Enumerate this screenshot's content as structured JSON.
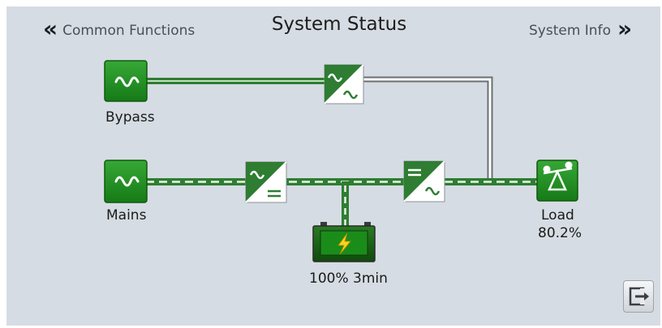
{
  "nav": {
    "left_chevron": "«",
    "left_label": "Common Functions",
    "right_label": "System Info",
    "right_chevron": "»"
  },
  "title": "System Status",
  "diagram": {
    "bypass": {
      "label": "Bypass",
      "icon": "sine-wave-icon"
    },
    "mains": {
      "label": "Mains",
      "icon": "sine-wave-icon"
    },
    "static_switch": {
      "icon": "ac-ac-converter-icon"
    },
    "rectifier": {
      "icon": "ac-dc-rectifier-icon"
    },
    "inverter": {
      "icon": "dc-ac-inverter-icon"
    },
    "battery": {
      "label": "100% 3min",
      "icon": "battery-lightning-icon"
    },
    "load": {
      "label": "Load",
      "value": "80.2%",
      "icon": "load-balance-icon"
    }
  },
  "exit": {
    "icon": "exit-icon"
  },
  "colors": {
    "background": "#d6dce3",
    "block_green": "#1f8a1f",
    "line_green": "#2e7d32",
    "battery_dark": "#15540f"
  }
}
